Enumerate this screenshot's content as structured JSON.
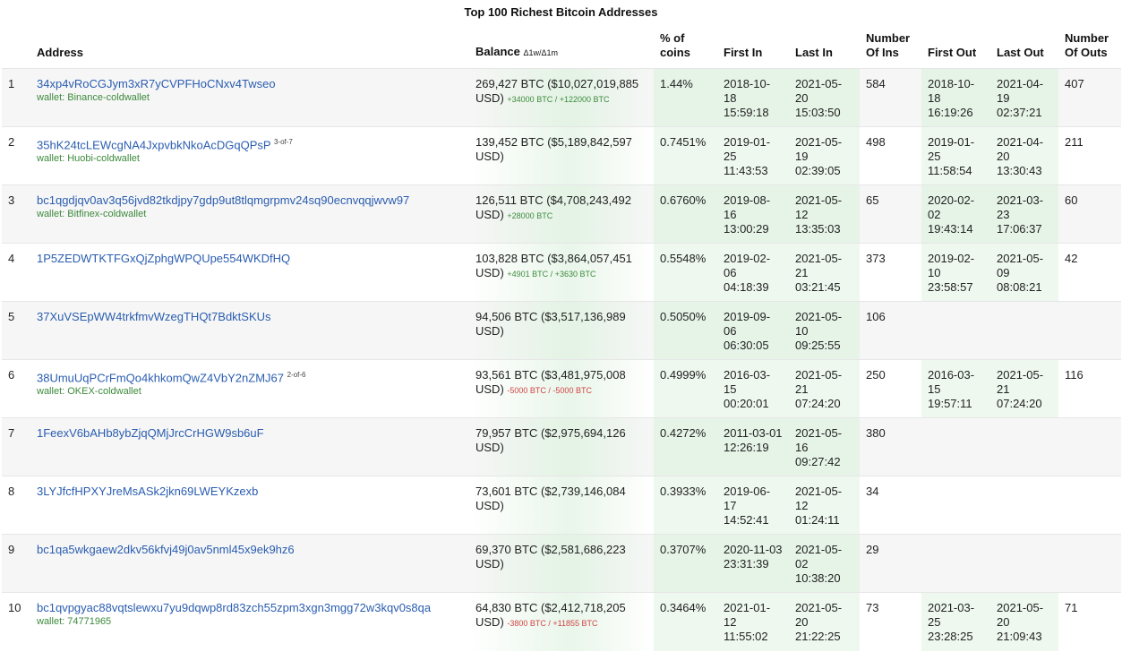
{
  "title": "Top 100 Richest Bitcoin Addresses",
  "columns": {
    "address": "Address",
    "balance": "Balance",
    "balance_delta": "Δ1w/Δ1m",
    "pct_coins": "% of coins",
    "first_in": "First In",
    "last_in": "Last In",
    "num_ins": "Number Of Ins",
    "first_out": "First Out",
    "last_out": "Last Out",
    "num_outs": "Number Of Outs"
  },
  "rows": [
    {
      "rank": "1",
      "address": "34xp4vRoCGJym3xR7yCVPFHoCNxv4Twseo",
      "multisig": "",
      "wallet": "wallet: Binance-coldwallet",
      "balance": "269,427 BTC ($10,027,019,885 USD)",
      "delta": "+34000 BTC / +122000 BTC",
      "delta_sign": "pos",
      "pct": "1.44%",
      "first_in": "2018-10-18 15:59:18",
      "last_in": "2021-05-20 15:03:50",
      "ins": "584",
      "first_out": "2018-10-18 16:19:26",
      "last_out": "2021-04-19 02:37:21",
      "outs": "407"
    },
    {
      "rank": "2",
      "address": "35hK24tcLEWcgNA4JxpvbkNkoAcDGqQPsP",
      "multisig": "3-of-7",
      "wallet": "wallet: Huobi-coldwallet",
      "balance": "139,452 BTC ($5,189,842,597 USD)",
      "delta": "",
      "delta_sign": "pos",
      "pct": "0.7451%",
      "first_in": "2019-01-25 11:43:53",
      "last_in": "2021-05-19 02:39:05",
      "ins": "498",
      "first_out": "2019-01-25 11:58:54",
      "last_out": "2021-04-20 13:30:43",
      "outs": "211"
    },
    {
      "rank": "3",
      "address": "bc1qgdjqv0av3q56jvd82tkdjpy7gdp9ut8tlqmgrpmv24sq90ecnvqqjwvw97",
      "multisig": "",
      "wallet": "wallet: Bitfinex-coldwallet",
      "balance": "126,511 BTC ($4,708,243,492 USD)",
      "delta": "+28000 BTC",
      "delta_sign": "pos",
      "pct": "0.6760%",
      "first_in": "2019-08-16 13:00:29",
      "last_in": "2021-05-12 13:35:03",
      "ins": "65",
      "first_out": "2020-02-02 19:43:14",
      "last_out": "2021-03-23 17:06:37",
      "outs": "60"
    },
    {
      "rank": "4",
      "address": "1P5ZEDWTKTFGxQjZphgWPQUpe554WKDfHQ",
      "multisig": "",
      "wallet": "",
      "balance": "103,828 BTC ($3,864,057,451 USD)",
      "delta": "+4901 BTC / +3630 BTC",
      "delta_sign": "pos",
      "pct": "0.5548%",
      "first_in": "2019-02-06 04:18:39",
      "last_in": "2021-05-21 03:21:45",
      "ins": "373",
      "first_out": "2019-02-10 23:58:57",
      "last_out": "2021-05-09 08:08:21",
      "outs": "42"
    },
    {
      "rank": "5",
      "address": "37XuVSEpWW4trkfmvWzegTHQt7BdktSKUs",
      "multisig": "",
      "wallet": "",
      "balance": "94,506 BTC ($3,517,136,989 USD)",
      "delta": "",
      "delta_sign": "pos",
      "pct": "0.5050%",
      "first_in": "2019-09-06 06:30:05",
      "last_in": "2021-05-10 09:25:55",
      "ins": "106",
      "first_out": "",
      "last_out": "",
      "outs": ""
    },
    {
      "rank": "6",
      "address": "38UmuUqPCrFmQo4khkomQwZ4VbY2nZMJ67",
      "multisig": "2-of-6",
      "wallet": "wallet: OKEX-coldwallet",
      "balance": "93,561 BTC ($3,481,975,008 USD)",
      "delta": "-5000 BTC / -5000 BTC",
      "delta_sign": "neg",
      "pct": "0.4999%",
      "first_in": "2016-03-15 00:20:01",
      "last_in": "2021-05-21 07:24:20",
      "ins": "250",
      "first_out": "2016-03-15 19:57:11",
      "last_out": "2021-05-21 07:24:20",
      "outs": "116"
    },
    {
      "rank": "7",
      "address": "1FeexV6bAHb8ybZjqQMjJrcCrHGW9sb6uF",
      "multisig": "",
      "wallet": "",
      "balance": "79,957 BTC ($2,975,694,126 USD)",
      "delta": "",
      "delta_sign": "pos",
      "pct": "0.4272%",
      "first_in": "2011-03-01 12:26:19",
      "last_in": "2021-05-16 09:27:42",
      "ins": "380",
      "first_out": "",
      "last_out": "",
      "outs": ""
    },
    {
      "rank": "8",
      "address": "3LYJfcfHPXYJreMsASk2jkn69LWEYKzexb",
      "multisig": "",
      "wallet": "",
      "balance": "73,601 BTC ($2,739,146,084 USD)",
      "delta": "",
      "delta_sign": "pos",
      "pct": "0.3933%",
      "first_in": "2019-06-17 14:52:41",
      "last_in": "2021-05-12 01:24:11",
      "ins": "34",
      "first_out": "",
      "last_out": "",
      "outs": ""
    },
    {
      "rank": "9",
      "address": "bc1qa5wkgaew2dkv56kfvj49j0av5nml45x9ek9hz6",
      "multisig": "",
      "wallet": "",
      "balance": "69,370 BTC ($2,581,686,223 USD)",
      "delta": "",
      "delta_sign": "pos",
      "pct": "0.3707%",
      "first_in": "2020-11-03 23:31:39",
      "last_in": "2021-05-02 10:38:20",
      "ins": "29",
      "first_out": "",
      "last_out": "",
      "outs": ""
    },
    {
      "rank": "10",
      "address": "bc1qvpgyac88vqtslewxu7yu9dqwp8rd83zch55zpm3xgn3mgg72w3kqv0s8qa",
      "multisig": "",
      "wallet": "wallet: 74771965",
      "balance": "64,830 BTC ($2,412,718,205 USD)",
      "delta": "-3800 BTC / +11855 BTC",
      "delta_sign": "neg",
      "pct": "0.3464%",
      "first_in": "2021-01-12 11:55:02",
      "last_in": "2021-05-20 21:22:25",
      "ins": "73",
      "first_out": "2021-03-25 23:28:25",
      "last_out": "2021-05-20 21:09:43",
      "outs": "71"
    }
  ]
}
